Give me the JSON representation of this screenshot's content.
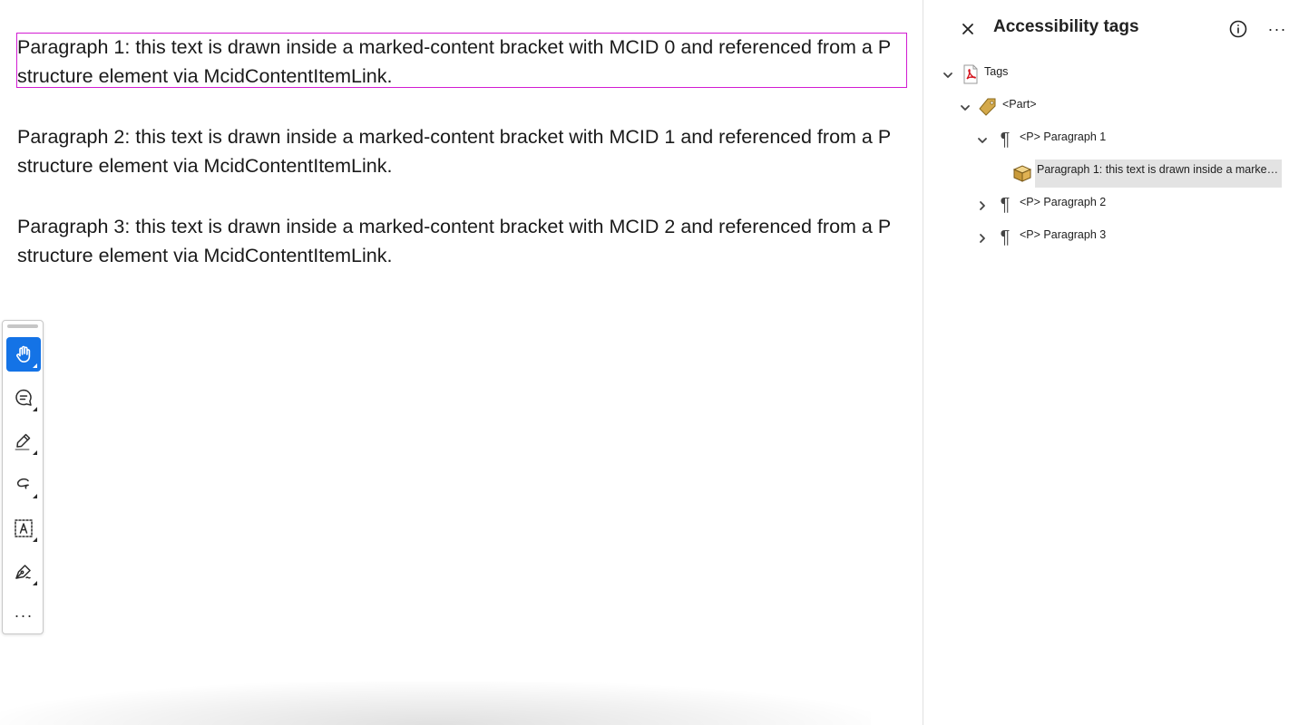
{
  "document": {
    "paragraphs": [
      "Paragraph 1: this text is drawn inside a marked-content bracket with MCID 0 and referenced from a P structure element via McidContentItemLink.",
      "Paragraph 2: this text is drawn inside a marked-content bracket with MCID 1 and referenced from a P structure element via McidContentItemLink.",
      "Paragraph 3: this text is drawn inside a marked-content bracket with MCID 2 and referenced from a P structure element via McidContentItemLink."
    ],
    "highlight_color": "#d21cd2"
  },
  "toolbar": {
    "tools": [
      {
        "name": "hand-icon",
        "active": true
      },
      {
        "name": "comment-icon",
        "active": false
      },
      {
        "name": "highlighter-icon",
        "active": false
      },
      {
        "name": "freehand-icon",
        "active": false
      },
      {
        "name": "text-select-icon",
        "active": false
      },
      {
        "name": "sign-pen-icon",
        "active": false
      }
    ],
    "more_label": "···",
    "accent": "#1473e6"
  },
  "panel": {
    "title": "Accessibility tags",
    "more_label": "···",
    "tree": {
      "root": {
        "label": "Tags",
        "expanded": true
      },
      "part": {
        "label": "<Part>",
        "expanded": true
      },
      "p1": {
        "label": "<P> Paragraph 1",
        "expanded": true
      },
      "p1_content": {
        "label": "Paragraph 1: this text is drawn inside a marked-co...",
        "selected": true
      },
      "p2": {
        "label": "<P> Paragraph 2",
        "expanded": false
      },
      "p3": {
        "label": "<P> Paragraph 3",
        "expanded": false
      }
    }
  }
}
